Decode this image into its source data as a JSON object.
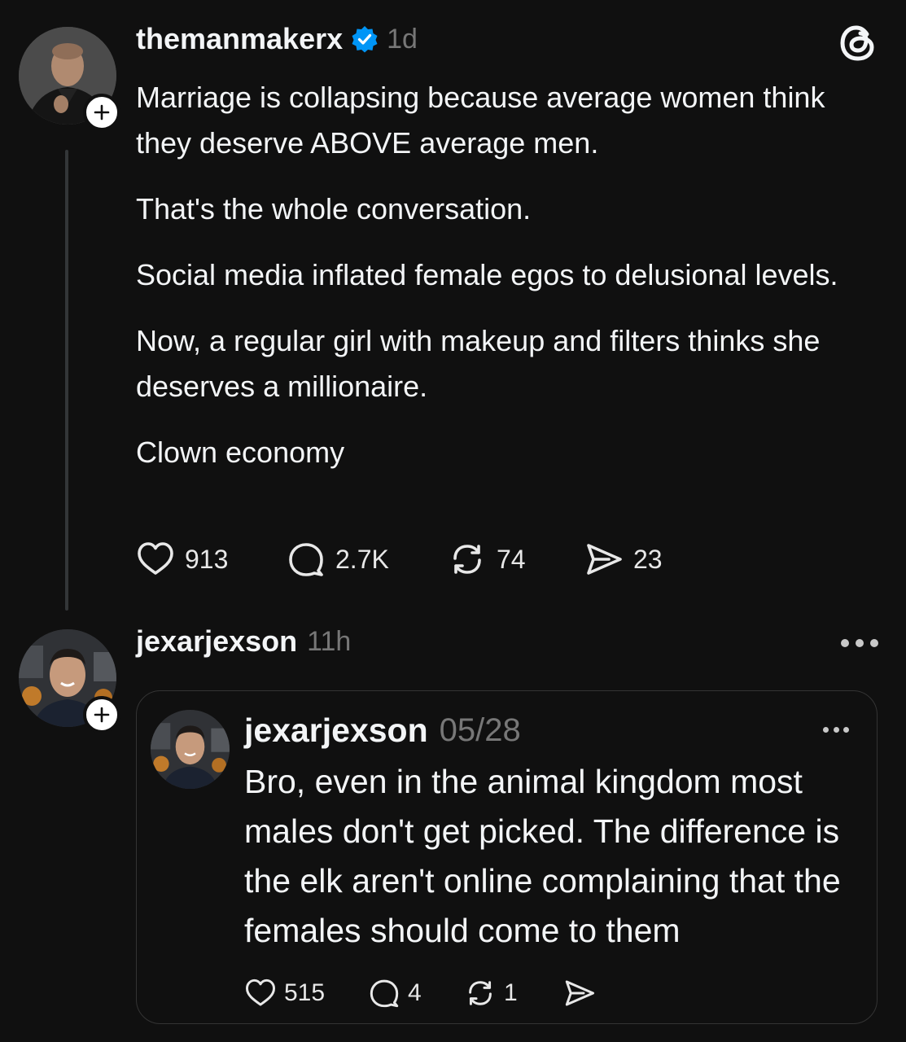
{
  "post": {
    "username": "themanmakerx",
    "verified": true,
    "time": "1d",
    "app_icon": "threads-logo-icon",
    "paragraphs": [
      "Marriage is collapsing because average women think they deserve ABOVE average men.",
      "That's the whole conversation.",
      "Social media inflated female egos to delusional levels.",
      "Now, a regular girl with makeup and filters thinks she deserves a millionaire.",
      "Clown economy"
    ],
    "actions": {
      "likes": "913",
      "replies": "2.7K",
      "reposts": "74",
      "shares": "23"
    }
  },
  "reply": {
    "username": "jexarjexson",
    "time": "11h",
    "more_icon": "more-horizontal-icon",
    "quoted": {
      "username": "jexarjexson",
      "date": "05/28",
      "text": "Bro,  even in the animal kingdom most males don't get picked.  The difference is the elk aren't online complaining that the females should come to them",
      "actions": {
        "likes": "515",
        "replies": "4",
        "reposts": "1"
      }
    }
  },
  "colors": {
    "background": "#101010",
    "text": "#f3f5f7",
    "muted": "#777777",
    "verified": "#0095f6",
    "thread_line": "#333638",
    "card_border": "#343434"
  }
}
